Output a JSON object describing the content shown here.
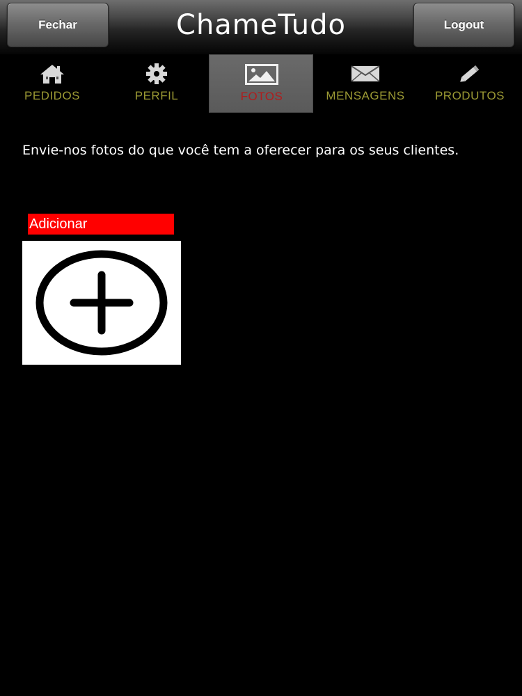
{
  "header": {
    "title": "ChameTudo",
    "left_button": "Fechar",
    "right_button": "Logout"
  },
  "tabs": [
    {
      "label": "PEDIDOS",
      "icon": "home-icon",
      "active": false
    },
    {
      "label": "PERFIL",
      "icon": "gear-icon",
      "active": false
    },
    {
      "label": "FOTOS",
      "icon": "image-icon",
      "active": true
    },
    {
      "label": "MENSAGENS",
      "icon": "envelope-icon",
      "active": false
    },
    {
      "label": "PRODUTOS",
      "icon": "pencil-icon",
      "active": false
    }
  ],
  "content": {
    "intro_text": "Envie-nos fotos do que você tem a oferecer para os seus clientes.",
    "add_label": "Adicionar",
    "add_icon": "plus-circle-icon"
  },
  "colors": {
    "tab_label": "#9c9a34",
    "tab_label_active": "#b01c1c",
    "add_label_bg": "#ff0000",
    "background": "#000000"
  }
}
